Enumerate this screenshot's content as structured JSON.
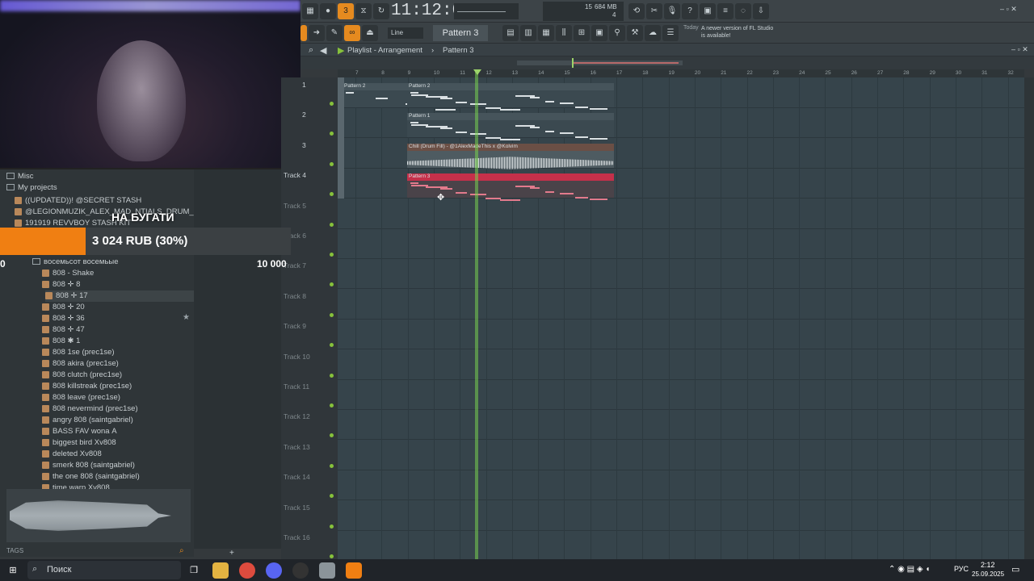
{
  "toolbar": {
    "time": "11:12:08",
    "mem": "684 MB",
    "cpu": "15",
    "voices": "4",
    "snap": "Line",
    "pattern": "Pattern 3",
    "news_day": "Today",
    "news_text": "A newer version of FL Studio is available!"
  },
  "playlist": {
    "title": "Playlist - Arrangement",
    "sep": "›",
    "pattern": "Pattern 3",
    "ruler": [
      "7",
      "8",
      "9",
      "10",
      "11",
      "12",
      "13",
      "14",
      "15",
      "16",
      "17",
      "18",
      "19",
      "20",
      "21",
      "22",
      "23",
      "24",
      "25",
      "26",
      "27",
      "28",
      "29",
      "30",
      "31",
      "32"
    ],
    "tracks": [
      "1",
      "2",
      "3",
      "Track 4",
      "Track 5",
      "Track 6",
      "Track 7",
      "Track 8",
      "Track 9",
      "Track 10",
      "Track 11",
      "Track 12",
      "Track 13",
      "Track 14",
      "Track 15",
      "Track 16"
    ],
    "clips": {
      "c1": "Pattern 2",
      "c2": "Pattern 2",
      "c3": "Pattern 1",
      "c4": "Chill (Drum Fill) - @1AlexMadeThis x @Kolvim",
      "c5": "Pattern 3"
    }
  },
  "browser": {
    "items": [
      "Misc",
      "My projects",
      "((UPDATED))! @SECRET STASH",
      "@LEGIONMUZIK_ALEX_MAD_NTIALS_DRUM_KIT_VOL_1",
      "191919 REVVBOY STASH KIT",
      "восемьсот восемьые",
      "808 - Shake",
      "808 ✛ 8",
      "808 ✛ 17",
      "808 ✛ 20",
      "808 ✛ 36",
      "808 ✛ 47",
      "808 ✱ 1",
      "808 1se (prec1se)",
      "808 akira (prec1se)",
      "808 clutch (prec1se)",
      "808 killstreak (prec1se)",
      "808 leave (prec1se)",
      "808 nevermind (prec1se)",
      "angry 808 (saintgabriel)",
      "BASS FAV wonа A",
      "biggest bird Xv808",
      "deleted Xv808",
      "smerk 808 (saintgabriel)",
      "the one 808 (saintgabriel)",
      "time warp Xv808"
    ],
    "tags": "TAGS"
  },
  "promo": {
    "title": "НА БУГАТИ",
    "amount": "3 024 RUB (30%)",
    "start": "0",
    "goal": "10 000"
  },
  "taskbar": {
    "search": "Поиск",
    "lang": "РУС",
    "time": "2:12",
    "date": "25.09.2025"
  }
}
